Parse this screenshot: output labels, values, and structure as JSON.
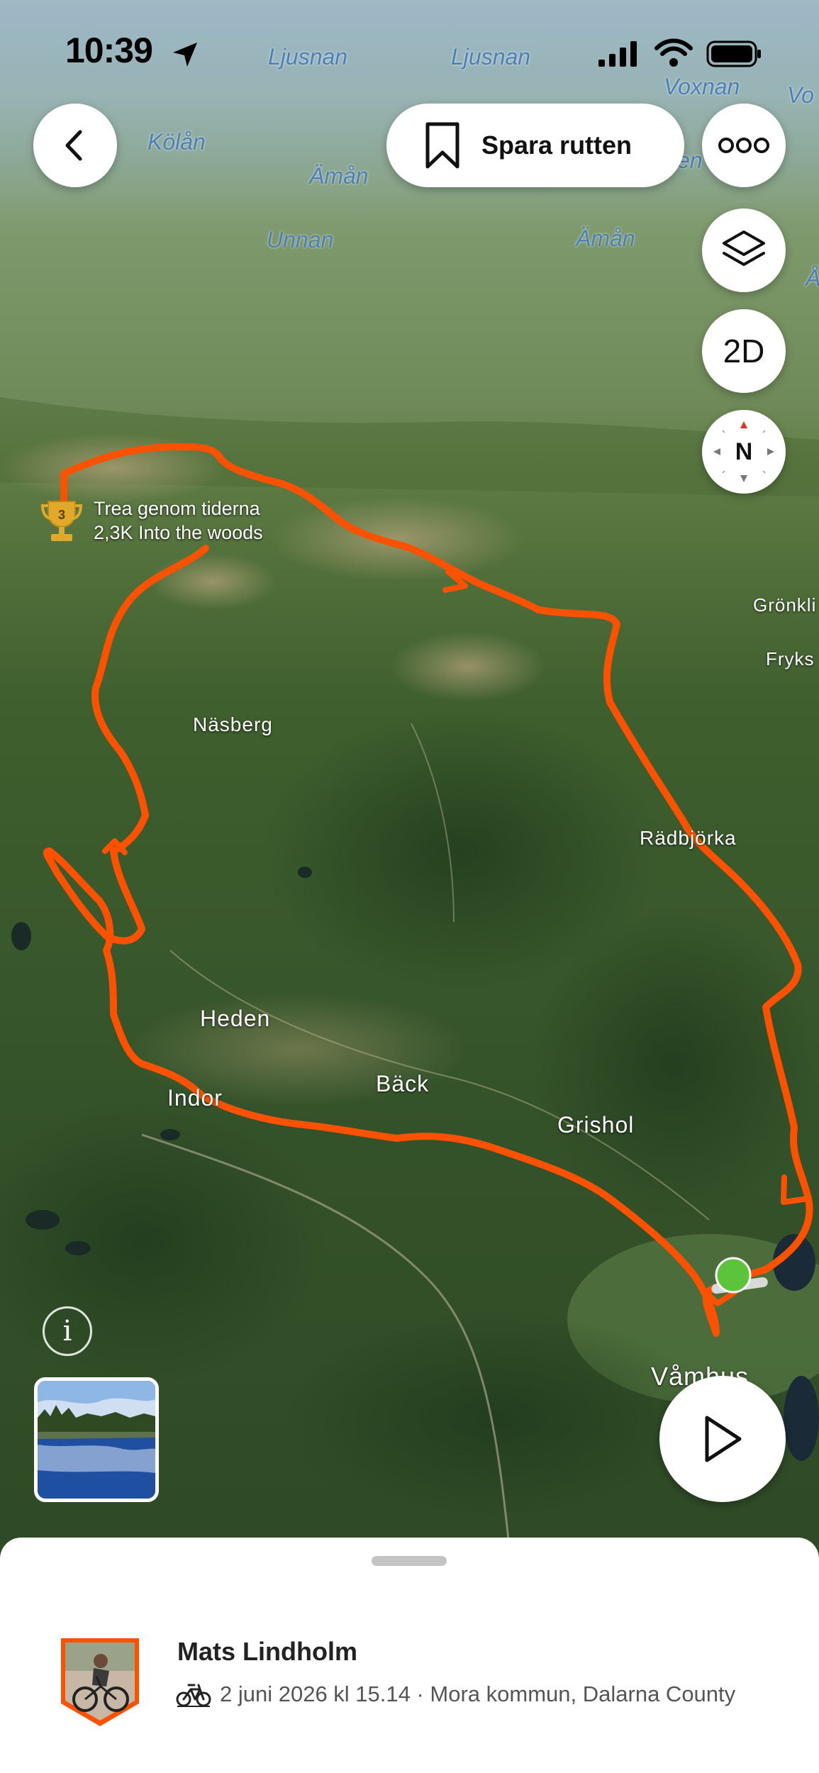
{
  "status_bar": {
    "time": "10:39"
  },
  "header": {
    "save_route_label": "Spara rutten"
  },
  "map_controls": {
    "mode_label": "2D",
    "compass_label": "N"
  },
  "map": {
    "water_labels": [
      "Ljusnan",
      "Ljusnan",
      "Voxnan",
      "Vo",
      "Kölån",
      "Ämån",
      "Unnan",
      "Ämån",
      "Å",
      "en"
    ],
    "place_labels": [
      "Näsberg",
      "Rädbjörka",
      "Heden",
      "Bäck",
      "Indor",
      "Grishol",
      "Våmhus",
      "Grönkli",
      "Fryks"
    ],
    "segment": {
      "rank": "3",
      "name": "Trea genom tiderna",
      "detail": "2,3K Into the woods"
    },
    "route_color": "#fc5200",
    "start_marker_color": "#5cc43a"
  },
  "activity": {
    "athlete_name": "Mats Lindholm",
    "details": "2 juni 2026 kl 15.14 · Mora kommun, Dalarna County",
    "sport_icon": "bike-icon"
  }
}
